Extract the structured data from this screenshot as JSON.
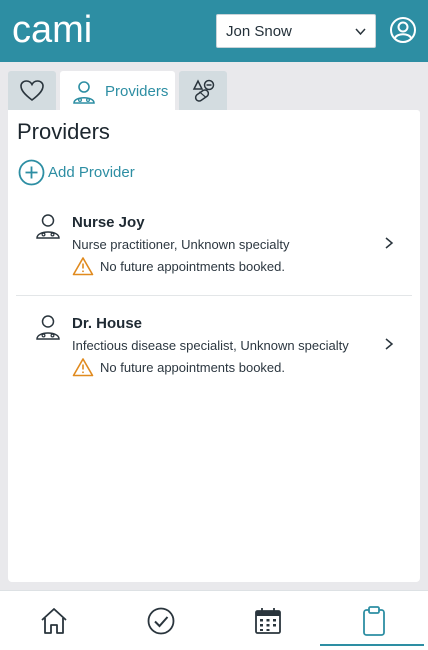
{
  "brand": {
    "logo_text": "cami",
    "accent": "#2d8ea3",
    "header_bg": "#2d8ea3"
  },
  "header": {
    "user_select": {
      "selected": "Jon Snow"
    },
    "icons": {
      "profile": "user-circle-icon",
      "dropdown": "chevron-down-icon"
    }
  },
  "tabs": [
    {
      "id": "health",
      "label": "",
      "icon": "heart-icon",
      "active": false
    },
    {
      "id": "providers",
      "label": "Providers",
      "icon": "doctor-icon",
      "active": true
    },
    {
      "id": "medications",
      "label": "",
      "icon": "pills-icon",
      "active": false
    }
  ],
  "main": {
    "title": "Providers",
    "add_label": "Add Provider",
    "providers": [
      {
        "name": "Nurse Joy",
        "specialty": "Nurse practitioner, Unknown specialty",
        "warning": "No future appointments booked."
      },
      {
        "name": "Dr. House",
        "specialty": "Infectious disease specialist, Unknown specialty",
        "warning": "No future appointments booked."
      }
    ]
  },
  "bottom_nav": [
    {
      "id": "home",
      "icon": "home-icon",
      "active": false
    },
    {
      "id": "tasks",
      "icon": "check-circle-icon",
      "active": false
    },
    {
      "id": "calendar",
      "icon": "calendar-icon",
      "active": false
    },
    {
      "id": "records",
      "icon": "clipboard-icon",
      "active": true
    }
  ],
  "colors": {
    "warning": "#e08a1e",
    "panel": "#ffffff",
    "page_bg": "#e9e9ec",
    "inactive_tab": "#d3dce0"
  }
}
